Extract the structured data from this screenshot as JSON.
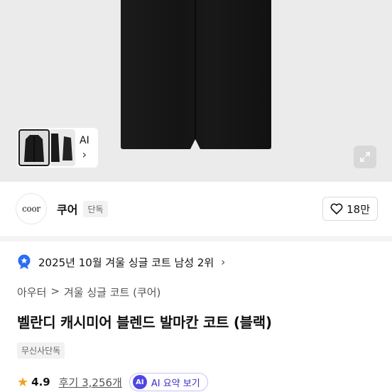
{
  "hero": {
    "ai_label": "AI",
    "ai_chevron": "›",
    "icons": {
      "expand": "expand-icon"
    }
  },
  "brand": {
    "logo_text": "coor",
    "name": "쿠어",
    "badge": "단독",
    "likes": "18만"
  },
  "ranking": {
    "text": "2025년 10월 겨울 싱글 코트 남성 2위",
    "chevron": "›"
  },
  "breadcrumb": {
    "items": [
      "아우터",
      ">",
      "겨울 싱글 코트 (쿠어)"
    ]
  },
  "product": {
    "title": "벨란디 캐시미어 블렌드 발마칸 코트 (블랙)",
    "tag": "무신사단독"
  },
  "rating": {
    "score": "4.9",
    "reviews": "후기 3,256개",
    "ai_badge": "AI",
    "ai_summary": "AI 요약 보기"
  },
  "colors": {
    "accent": "#4f46e5",
    "star": "#f0a020",
    "rank_badge": "#2b6cf6"
  }
}
